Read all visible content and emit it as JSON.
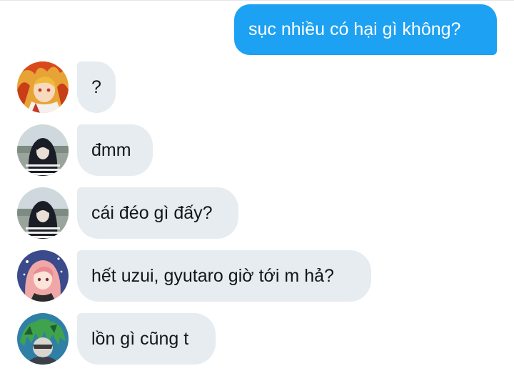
{
  "conversation": {
    "outgoing": [
      {
        "text": "sục nhiều có hại gì không?",
        "color": "#1da1f2"
      }
    ],
    "incoming": [
      {
        "text": "?",
        "avatar_icon": "rengoku-avatar-icon"
      },
      {
        "text": "đmm",
        "avatar_icon": "obanai-avatar-icon"
      },
      {
        "text": "cái đéo gì đấy?",
        "avatar_icon": "obanai-avatar-icon"
      },
      {
        "text": "hết uzui, gyutaro giờ tới m hả?",
        "avatar_icon": "sabito-avatar-icon"
      },
      {
        "text": "lồn gì cũng t",
        "avatar_icon": "green-hair-avatar-icon"
      }
    ],
    "incoming_bubble_color": "#e6ecf0"
  }
}
